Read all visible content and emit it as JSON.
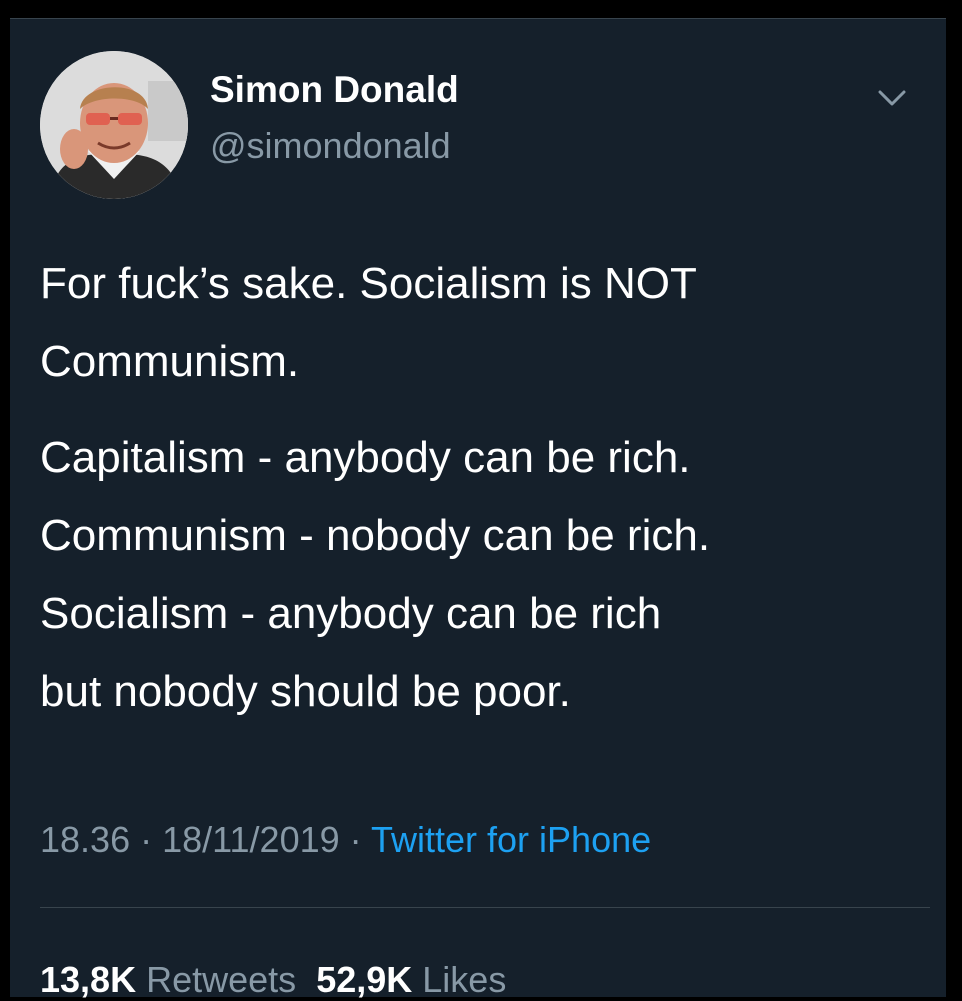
{
  "user": {
    "display_name": "Simon Donald",
    "handle": "@simondonald"
  },
  "icons": {
    "avatar": "profile-photo",
    "more": "chevron-down-icon"
  },
  "tweet": {
    "lines": [
      "For fuck’s sake. Socialism is NOT",
      "Communism.",
      "Capitalism - anybody can be rich.",
      "Communism - nobody can be rich.",
      "Socialism - anybody can be rich",
      "but nobody should be poor."
    ]
  },
  "meta": {
    "time": "18.36",
    "separator": "·",
    "date": "18/11/2019",
    "source": "Twitter for iPhone"
  },
  "stats": {
    "retweets_count": "13,8K",
    "retweets_label": "Retweets",
    "likes_count": "52,9K",
    "likes_label": "Likes"
  },
  "colors": {
    "background": "#15202b",
    "text": "#ffffff",
    "secondary": "#8899a6",
    "accent": "#1da1f2",
    "divider": "#38444d"
  }
}
